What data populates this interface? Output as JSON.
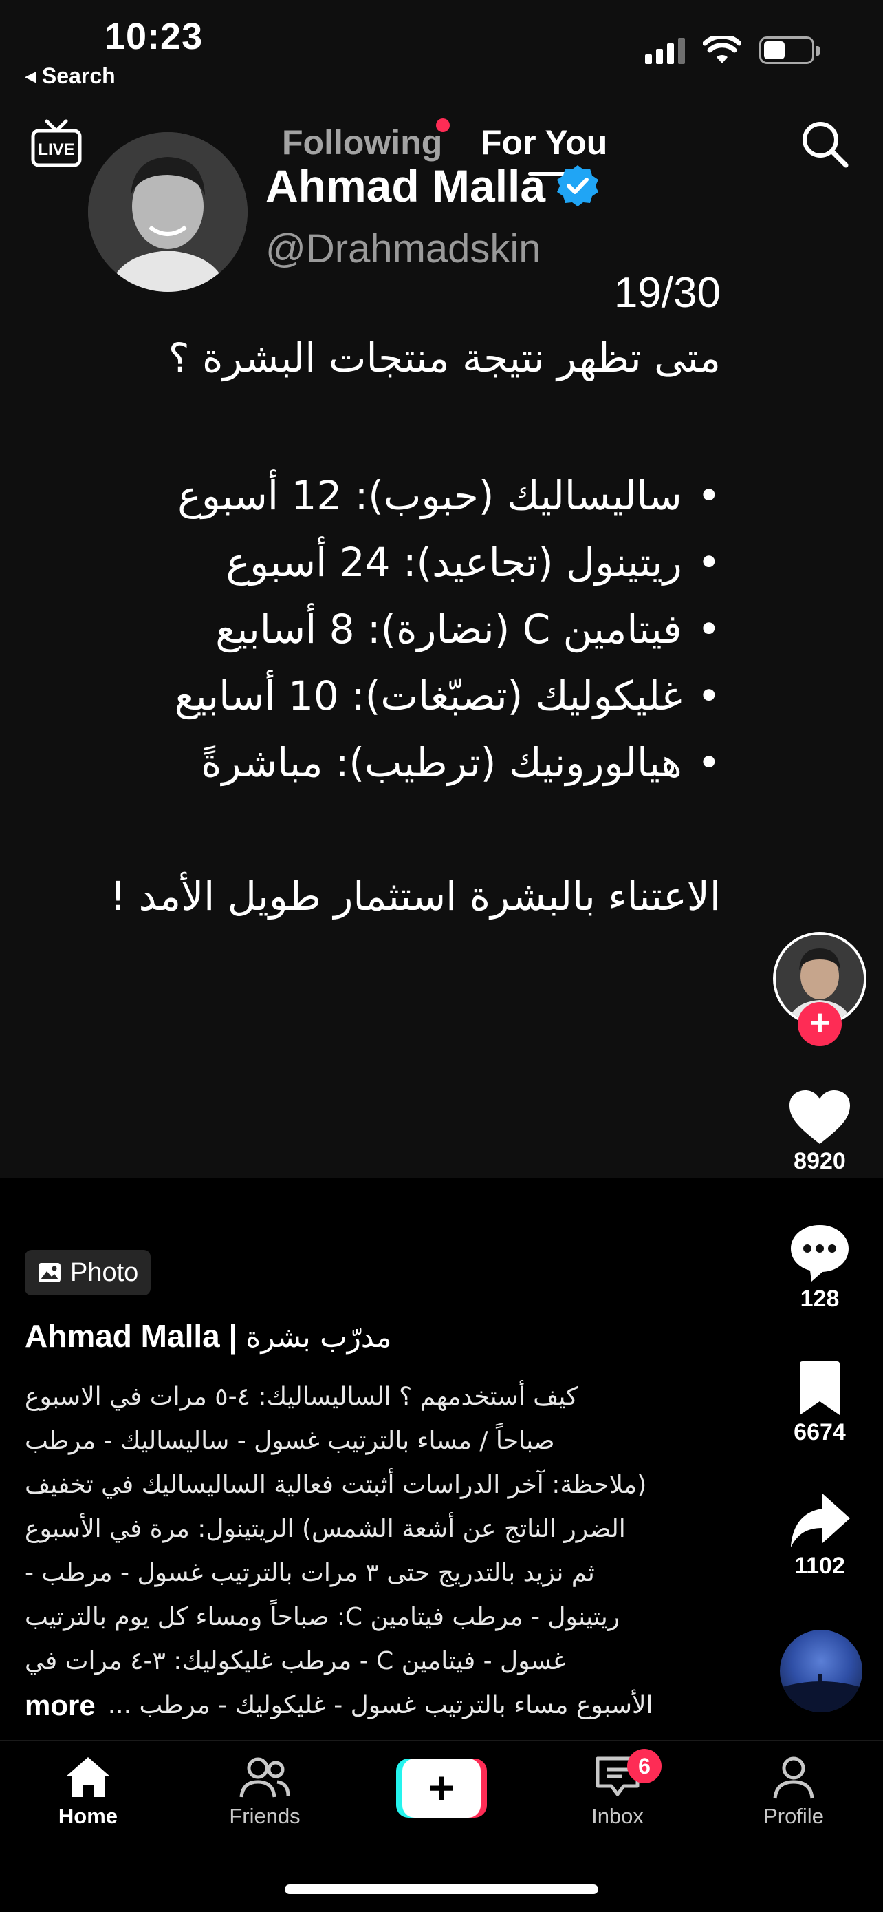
{
  "status_bar": {
    "time": "10:23",
    "back_label": "Search"
  },
  "top_nav": {
    "following_label": "Following",
    "for_you_label": "For You",
    "live_icon": "live-tv-icon",
    "search_icon": "search-icon"
  },
  "post": {
    "author_name": "Ahmad Malla",
    "handle": "@Drahmadskin",
    "counter": "19/30",
    "question": "متى تظهر نتيجة منتجات البشرة ؟",
    "bullets": [
      "ساليساليك (حبوب): 12 أسبوع",
      "ريتينول (تجاعيد): 24 أسبوع",
      "فيتامين C (نضارة): 8 أسابيع",
      "غليكوليك (تصبّغات): 10 أسابيع",
      "هيالورونيك (ترطيب): مباشرةً"
    ],
    "bullet_mark": "•",
    "closing": "الاعتناء بالبشرة استثمار طويل الأمد !"
  },
  "rail": {
    "follow_plus": "+",
    "likes": "8920",
    "comments": "128",
    "saves": "6674",
    "shares": "1102"
  },
  "caption": {
    "photo_badge": "Photo",
    "author": "Ahmad Malla |",
    "role": "مدرّب بشرة",
    "lines": [
      "كيف أستخدمهم ؟ الساليساليك: ٤-٥ مرات في الاسبوع",
      "صباحاً / مساء بالترتيب  غسول - ساليساليك - مرطب",
      "(ملاحظة: آخر الدراسات أثبتت فعالية الساليساليك في تخفيف",
      "الضرر الناتج عن أشعة الشمس) الريتينول: مرة في الأسبوع",
      "ثم نزيد بالتدريج حتى ٣ مرات بالترتيب غسول - مرطب -",
      "ريتينول - مرطب فيتامين C: صباحاً ومساء كل يوم بالترتيب",
      "غسول - فيتامين C - مرطب غليكوليك: ٣-٤  مرات في",
      "الأسبوع مساء بالترتيب  غسول - غليكوليك - مرطب ..."
    ],
    "more_label": "more"
  },
  "bottom_nav": {
    "home": "Home",
    "friends": "Friends",
    "create": "+",
    "inbox": "Inbox",
    "inbox_badge": "6",
    "profile": "Profile"
  },
  "colors": {
    "accent": "#fe2c55",
    "cyan": "#25f4ee",
    "verified": "#20a5f5",
    "background": "#000000"
  }
}
